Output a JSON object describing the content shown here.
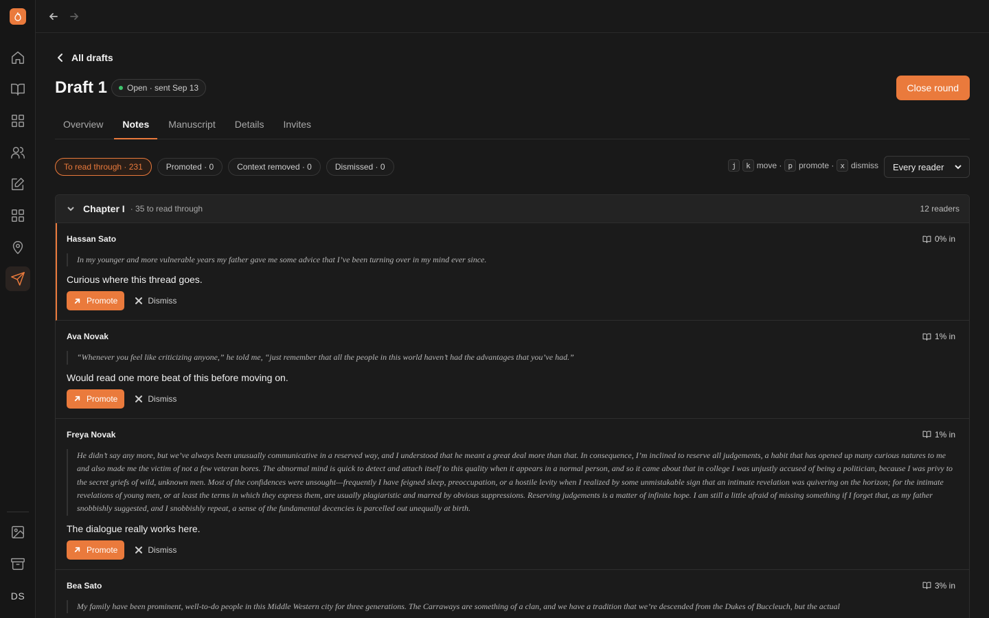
{
  "app": {
    "accent": "#ea7a3c",
    "avatar_initials": "DS"
  },
  "sidebar": {
    "items": [
      {
        "name": "home-icon"
      },
      {
        "name": "book-icon"
      },
      {
        "name": "dashboard-icon"
      },
      {
        "name": "people-icon"
      },
      {
        "name": "edit-icon"
      },
      {
        "name": "apps-icon"
      },
      {
        "name": "location-icon"
      },
      {
        "name": "send-icon",
        "active": true
      }
    ],
    "bottom": [
      {
        "name": "image-icon"
      },
      {
        "name": "archive-icon"
      }
    ]
  },
  "header": {
    "back_label": "All drafts",
    "title": "Draft 1",
    "status": "Open · sent Sep 13",
    "status_color": "#3ec46d",
    "close_round_label": "Close round"
  },
  "tabs": [
    {
      "label": "Overview"
    },
    {
      "label": "Notes",
      "active": true
    },
    {
      "label": "Manuscript"
    },
    {
      "label": "Details"
    },
    {
      "label": "Invites"
    }
  ],
  "filters": [
    {
      "label": "To read through · 231",
      "active": true
    },
    {
      "label": "Promoted · 0"
    },
    {
      "label": "Context removed · 0"
    },
    {
      "label": "Dismissed · 0"
    }
  ],
  "shortcuts": {
    "k1": "j",
    "k2": "k",
    "move": "move ·",
    "k3": "p",
    "promote": "promote ·",
    "k4": "x",
    "dismiss": "dismiss"
  },
  "reader_select": {
    "value": "Every reader"
  },
  "chapter": {
    "name": "Chapter I",
    "count": "· 35 to read through",
    "readers": "12 readers"
  },
  "notes": [
    {
      "author": "Hassan Sato",
      "progress": "0% in",
      "quote": "In my younger and more vulnerable years my father gave me some advice that I’ve been turning over in my mind ever since.",
      "comment": "Curious where this thread goes.",
      "active": true
    },
    {
      "author": "Ava Novak",
      "progress": "1% in",
      "quote": "“Whenever you feel like criticizing anyone,” he told me, “just remember that all the people in this world haven’t had the advantages that you’ve had.”",
      "comment": "Would read one more beat of this before moving on."
    },
    {
      "author": "Freya Novak",
      "progress": "1% in",
      "quote": "He didn’t say any more, but we’ve always been unusually communicative in a reserved way, and I understood that he meant a great deal more than that. In consequence, I’m inclined to reserve all judgements, a habit that has opened up many curious natures to me and also made me the victim of not a few veteran bores. The abnormal mind is quick to detect and attach itself to this quality when it appears in a normal person, and so it came about that in college I was unjustly accused of being a politician, because I was privy to the secret griefs of wild, unknown men. Most of the confidences were unsought—frequently I have feigned sleep, preoccupation, or a hostile levity when I realized by some unmistakable sign that an intimate revelation was quivering on the horizon; for the intimate revelations of young men, or at least the terms in which they express them, are usually plagiaristic and marred by obvious suppressions. Reserving judgements is a matter of infinite hope. I am still a little afraid of missing something if I forget that, as my father snobbishly suggested, and I snobbishly repeat, a sense of the fundamental decencies is parcelled out unequally at birth.",
      "comment": "The dialogue really works here."
    },
    {
      "author": "Bea Sato",
      "progress": "3% in",
      "quote": "My family have been prominent, well-to-do people in this Middle Western city for three generations. The Carraways are something of a clan, and we have a tradition that we’re descended from the Dukes of Buccleuch, but the actual",
      "comment": ""
    }
  ],
  "actions": {
    "promote_label": "Promote",
    "dismiss_label": "Dismiss"
  }
}
